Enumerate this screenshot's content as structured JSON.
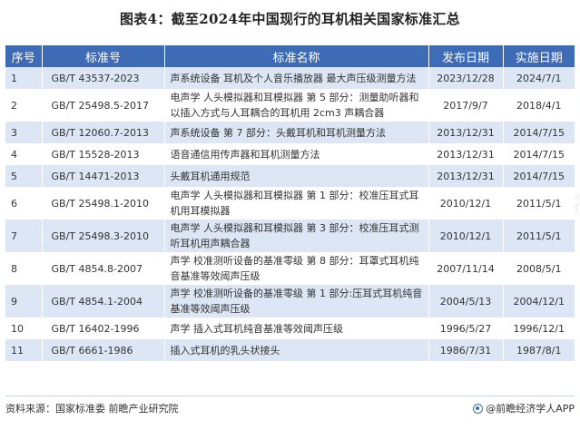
{
  "title": "图表4：截至2024年中国现行的耳机相关国家标准汇总",
  "table": {
    "headers": [
      "序号",
      "标准号",
      "标准名称",
      "发布日期",
      "实施日期"
    ],
    "rows": [
      {
        "seq": "1",
        "code": "GB/T 43537-2023",
        "name": "声系统设备  耳机及个人音乐播放器  最大声压级测量方法",
        "pub": "2023/12/28",
        "impl": "2024/7/1"
      },
      {
        "seq": "2",
        "code": "GB/T 25498.5-2017",
        "name": "电声学  人头模拟器和耳模拟器  第 5 部分：测量助听器和以插入方式与人耳耦合的耳机用 2cm3 声耦合器",
        "pub": "2017/9/7",
        "impl": "2018/4/1"
      },
      {
        "seq": "3",
        "code": "GB/T 12060.7-2013",
        "name": "声系统设备  第 7 部分：头戴耳机和耳机测量方法",
        "pub": "2013/12/31",
        "impl": "2014/7/15"
      },
      {
        "seq": "4",
        "code": "GB/T 15528-2013",
        "name": "语音通信用传声器和耳机测量方法",
        "pub": "2013/12/31",
        "impl": "2014/7/15"
      },
      {
        "seq": "5",
        "code": "GB/T 14471-2013",
        "name": "头戴耳机通用规范",
        "pub": "2013/12/31",
        "impl": "2014/7/15"
      },
      {
        "seq": "6",
        "code": "GB/T 25498.1-2010",
        "name": "电声学  人头模拟器和耳模拟器  第 1 部分：校准压耳式耳机用耳模拟器",
        "pub": "2010/12/1",
        "impl": "2011/5/1"
      },
      {
        "seq": "7",
        "code": "GB/T 25498.3-2010",
        "name": "电声学  人头模拟器和耳模拟器  第 3 部分：校准压耳式测听耳机用声耦合器",
        "pub": "2010/12/1",
        "impl": "2011/5/1"
      },
      {
        "seq": "8",
        "code": "GB/T 4854.8-2007",
        "name": "声学  校准测听设备的基准零级  第 8 部分：耳罩式耳机纯音基准等效阈声压级",
        "pub": "2007/11/14",
        "impl": "2008/5/1"
      },
      {
        "seq": "9",
        "code": "GB/T 4854.1-2004",
        "name": "声学  校准测听设备的基准零级  第 1 部分:压耳式耳机纯音基准等效阈声压级",
        "pub": "2004/5/13",
        "impl": "2004/12/1"
      },
      {
        "seq": "10",
        "code": "GB/T 16402-1996",
        "name": "声学  插入式耳机纯音基准等效阈声压级",
        "pub": "1996/5/27",
        "impl": "1996/12/1"
      },
      {
        "seq": "11",
        "code": "GB/T 6661-1986",
        "name": "插入式耳机的乳头状接头",
        "pub": "1986/7/31",
        "impl": "1987/8/1"
      }
    ]
  },
  "footer": {
    "source": "资料来源：国家标准委 前瞻产业研究院",
    "brand": "@前瞻经济学人APP"
  },
  "watermark": "前瞻产业研究院",
  "colors": {
    "header_bg": "#3d6bb5",
    "stripe": "#dce6f4"
  }
}
